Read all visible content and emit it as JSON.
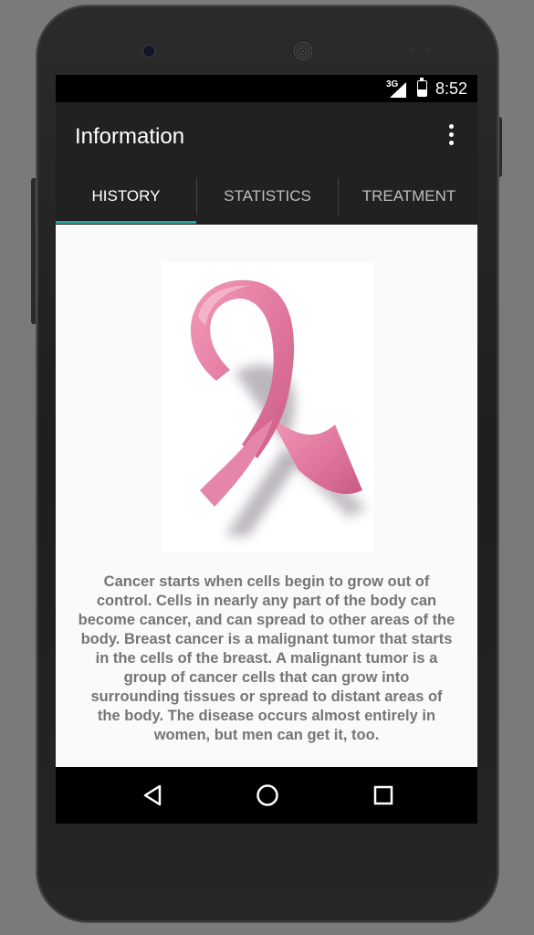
{
  "status_bar": {
    "network": "3G",
    "time": "8:52"
  },
  "app_bar": {
    "title": "Information",
    "overflow_icon": "more-vert-icon"
  },
  "tabs": [
    {
      "label": "HISTORY",
      "selected": true
    },
    {
      "label": "STATISTICS",
      "selected": false
    },
    {
      "label": "TREATMENT",
      "selected": false
    }
  ],
  "accent_color": "#26a69a",
  "content": {
    "image": "pink-ribbon-image",
    "text": "Cancer starts when cells begin to grow out of control. Cells in nearly any part of the body can become cancer, and can spread to other areas of the body. Breast cancer is a malignant tumor that starts in the cells of the breast. A malignant tumor is a group of cancer cells that can grow into surrounding tissues or spread to distant areas of the body. The disease occurs almost entirely in women, but men can get it, too."
  },
  "nav_bar": {
    "back_icon": "back-triangle-icon",
    "home_icon": "home-circle-icon",
    "recents_icon": "recents-square-icon"
  }
}
